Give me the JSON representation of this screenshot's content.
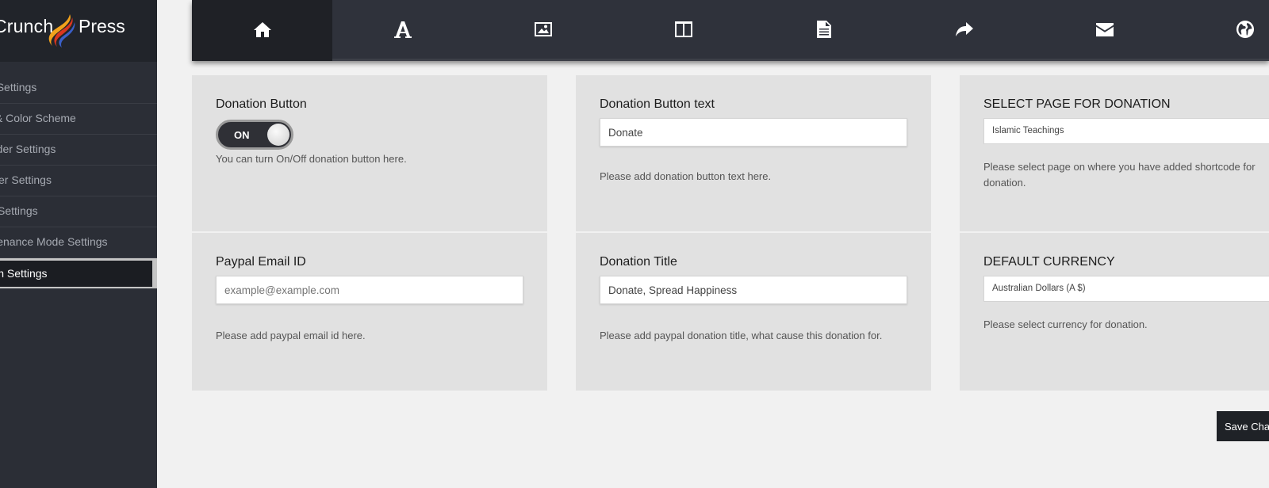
{
  "logo": {
    "left": "Crunch",
    "right": "Press"
  },
  "sidebar": {
    "items": [
      {
        "label": "General Settings"
      },
      {
        "label": "Fonts & Color Scheme"
      },
      {
        "label": "Header Settings"
      },
      {
        "label": "Footer Settings"
      },
      {
        "label": "Social Settings"
      },
      {
        "label": "Maintenance Mode Settings"
      },
      {
        "label": "Donation Settings"
      }
    ]
  },
  "topnav": {
    "tabs": [
      {
        "icon": "home-icon"
      },
      {
        "icon": "font-icon"
      },
      {
        "icon": "image-icon"
      },
      {
        "icon": "columns-icon"
      },
      {
        "icon": "document-icon"
      },
      {
        "icon": "share-icon"
      },
      {
        "icon": "envelope-icon"
      },
      {
        "icon": "globe-icon"
      }
    ]
  },
  "cards": {
    "donation_button": {
      "title": "Donation Button",
      "toggle": "ON",
      "help": "You can turn On/Off donation button here."
    },
    "donation_button_text": {
      "title": "Donation Button text",
      "value": "Donate",
      "help": "Please add donation button text here."
    },
    "select_page": {
      "title": "SELECT PAGE FOR DONATION",
      "value": "Islamic Teachings",
      "help": "Please select page on where you have added shortcode for donation."
    },
    "paypal_email": {
      "title": "Paypal Email ID",
      "placeholder": "example@example.com",
      "help": "Please add paypal email id here."
    },
    "donation_title": {
      "title": "Donation Title",
      "value": "Donate, Spread Happiness",
      "help": "Please add paypal donation title, what cause this donation for."
    },
    "default_currency": {
      "title": "DEFAULT CURRENCY",
      "value": "Australian Dollars (A $)",
      "help": "Please select currency for donation."
    }
  },
  "save_button": "Save Changes",
  "colors": {
    "sidebar": "#2b2e36",
    "nav": "#2f323b",
    "card": "#e1e1e1",
    "page": "#f1f1f1"
  }
}
